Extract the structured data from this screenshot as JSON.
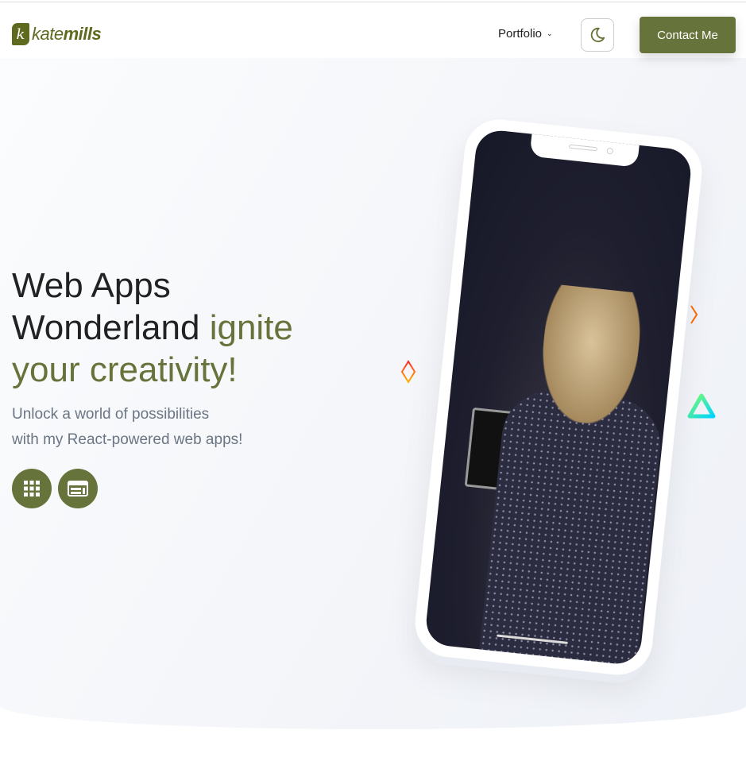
{
  "header": {
    "logo": {
      "mark": "k",
      "text_light": "kate",
      "text_bold": "mills"
    },
    "nav": {
      "portfolio_label": "Portfolio"
    },
    "theme_toggle_icon": "moon-icon",
    "contact_label": "Contact Me"
  },
  "hero": {
    "title_line1": "Web Apps",
    "title_line2": "Wonderland",
    "title_accent_1": "ignite",
    "title_accent_2": "your creativity!",
    "subtitle_line1": "Unlock a world of possibilities",
    "subtitle_line2": "with my React-powered web apps!",
    "buttons": [
      {
        "icon": "grid-icon"
      },
      {
        "icon": "layout-icon"
      }
    ]
  },
  "colors": {
    "accent": "#66733a",
    "text": "#222222",
    "muted": "#6b7584"
  }
}
